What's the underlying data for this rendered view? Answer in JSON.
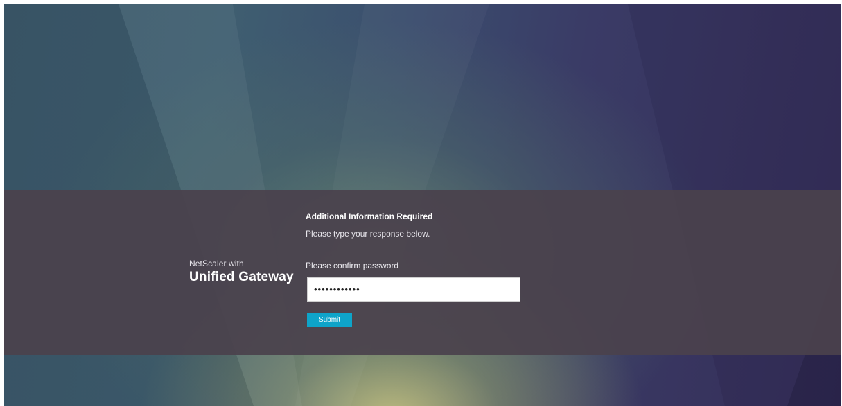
{
  "brand": {
    "prefix": "NetScaler with",
    "product": "Unified Gateway"
  },
  "form": {
    "heading": "Additional Information Required",
    "instruction": "Please type your response below.",
    "field_label": "Please confirm password",
    "password_value": "••••••••••••",
    "submit_label": "Submit"
  },
  "colors": {
    "submit_button": "#0ea4c9",
    "banner": "#4a424c"
  }
}
